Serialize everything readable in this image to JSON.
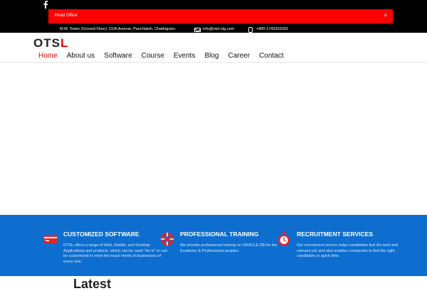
{
  "topbar": {
    "social": "facebook-icon",
    "alert": {
      "text": "Head Office",
      "close": "×"
    },
    "address": "M.M. Tower (Ground Floor), CDA Avenue, Panchlaish, Chattogram.",
    "email": "info@otsl-ctg.com",
    "phone": "+880-1743333392"
  },
  "brand": {
    "part1": "OTS",
    "part2": "L"
  },
  "nav": {
    "items": [
      {
        "label": "Home",
        "active": true
      },
      {
        "label": "About us",
        "active": false
      },
      {
        "label": "Software",
        "active": false
      },
      {
        "label": "Course",
        "active": false
      },
      {
        "label": "Events",
        "active": false
      },
      {
        "label": "Blog",
        "active": false
      },
      {
        "label": "Career",
        "active": false
      },
      {
        "label": "Contact",
        "active": false
      }
    ]
  },
  "services": [
    {
      "icon": "credit-card-icon",
      "title": "CUSTOMIZED SOFTWARE",
      "desc": "OTSL offers a range of Web, Mobile, and Desktop Applications and products, which can be used \"As-Is\" or can be customized to meet the exact needs of businesses of every size."
    },
    {
      "icon": "lifebuoy-icon",
      "title": "PROFESSIONAL TRAINING",
      "desc": "We provide professional training on ORACLE DB for the Ecademic & Professional peoples."
    },
    {
      "icon": "stopwatch-icon",
      "title": "RECRUITMENT SERVICES",
      "desc": "Our recruitment service helps candidates find the best and relevant job and also enables companies to find the right candidates in quick time."
    }
  ],
  "bottom_heading": "Latest"
}
